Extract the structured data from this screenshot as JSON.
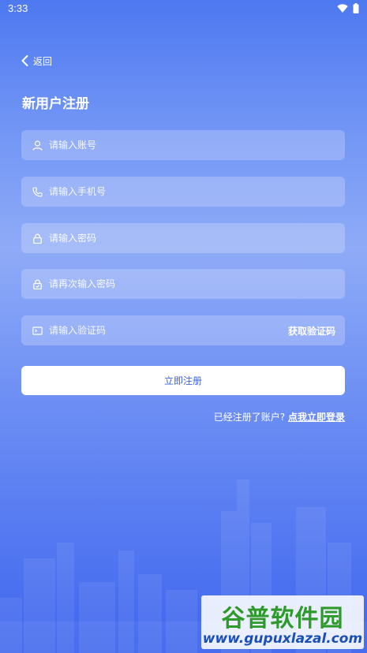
{
  "status_bar": {
    "time": "3:33"
  },
  "header": {
    "back_label": "返回",
    "title": "新用户注册"
  },
  "form": {
    "account_placeholder": "请输入账号",
    "phone_placeholder": "请输入手机号",
    "password_placeholder": "请输入密码",
    "confirm_password_placeholder": "请再次输入密码",
    "code_placeholder": "请输入验证码",
    "get_code_label": "获取验证码",
    "register_label": "立即注册"
  },
  "footer": {
    "has_account_text": "已经注册了账户?",
    "login_link": "点我立即登录"
  },
  "watermark": {
    "title": "谷普软件园",
    "url": "www.gupuxlazal.com"
  },
  "colors": {
    "accent": "#3b63e6",
    "watermark_green": "#2f9a2c",
    "watermark_blue": "#1b4fb8"
  }
}
